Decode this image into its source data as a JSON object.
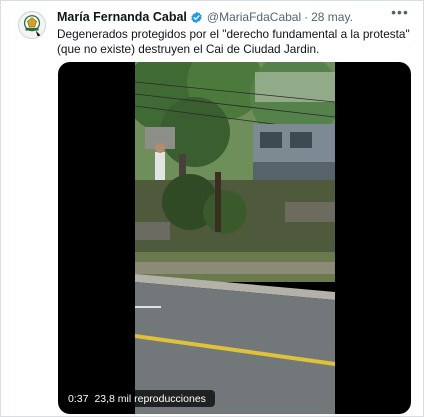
{
  "tweet": {
    "author_name": "María Fernanda Cabal",
    "handle": "@MariaFdaCabal",
    "separator": "·",
    "date": "28 may.",
    "more_glyph": "•••",
    "text": "Degenerados protegidos por el \"derecho fundamental a la protesta\" (que no existe) destruyen el Cai de Ciudad Jardin."
  },
  "media": {
    "duration": "0:37",
    "views": "23,8 mil reproducciones"
  },
  "colors": {
    "verified": "#1d9bf0",
    "secondary_text": "#536471",
    "media_background": "#000000"
  },
  "icons": {
    "verified": "verified-badge-icon",
    "more": "more-options-icon",
    "avatar": "avatar-emblem"
  }
}
